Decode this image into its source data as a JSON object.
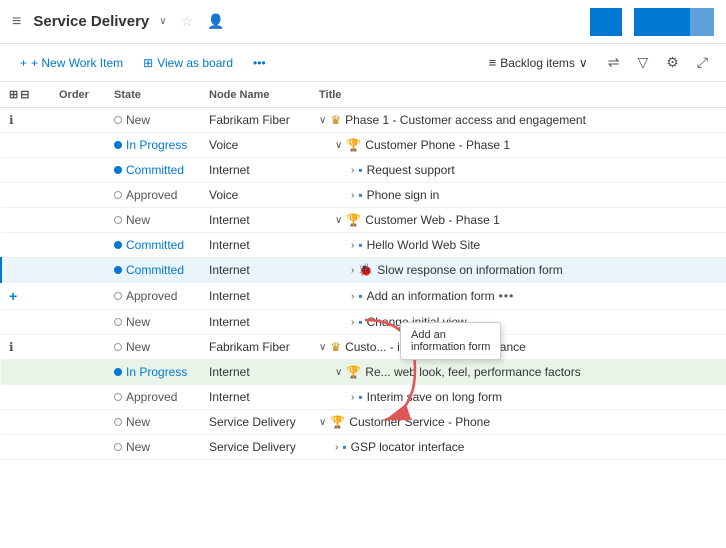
{
  "header": {
    "icon": "≡",
    "title": "Service Delivery",
    "chevron": "∨",
    "star": "☆",
    "person": "👤"
  },
  "toolbar": {
    "new_work_item": "+ New Work Item",
    "view_as_board": "View as board",
    "more_options": "•••",
    "backlog_items": "Backlog items",
    "filter_icon": "▽",
    "settings_icon": "⚙",
    "expand_icon": "⤢"
  },
  "columns": [
    "",
    "Order",
    "State",
    "Node Name",
    "Title"
  ],
  "rows": [
    {
      "id": "r1",
      "expand": "⊕",
      "order": "",
      "order_info": true,
      "state": "New",
      "state_type": "new",
      "node": "Fabrikam Fiber",
      "title_indent": 0,
      "title_chevron": "down",
      "title_icon": "crown",
      "title_text": "Phase 1 - Customer access and engagement",
      "highlighted": false,
      "active": false
    },
    {
      "id": "r2",
      "expand": "",
      "order": "",
      "state": "In Progress",
      "state_type": "inprogress",
      "node": "Voice",
      "title_indent": 1,
      "title_chevron": "down",
      "title_icon": "trophy",
      "title_text": "Customer Phone - Phase 1",
      "highlighted": false,
      "active": false
    },
    {
      "id": "r3",
      "expand": "",
      "order": "",
      "state": "Committed",
      "state_type": "committed",
      "node": "Internet",
      "title_indent": 2,
      "title_chevron": "right",
      "title_icon": "task",
      "title_text": "Request support",
      "highlighted": false,
      "active": false
    },
    {
      "id": "r4",
      "expand": "",
      "order": "",
      "state": "Approved",
      "state_type": "approved",
      "node": "Voice",
      "title_indent": 2,
      "title_chevron": "right",
      "title_icon": "task",
      "title_text": "Phone sign in",
      "highlighted": false,
      "active": false
    },
    {
      "id": "r5",
      "expand": "",
      "order": "",
      "state": "New",
      "state_type": "new",
      "node": "Internet",
      "title_indent": 1,
      "title_chevron": "down",
      "title_icon": "trophy",
      "title_text": "Customer Web - Phase 1",
      "highlighted": false,
      "active": false
    },
    {
      "id": "r6",
      "expand": "",
      "order": "",
      "state": "Committed",
      "state_type": "committed",
      "node": "Internet",
      "title_indent": 2,
      "title_chevron": "right",
      "title_icon": "task",
      "title_text": "Hello World Web Site",
      "highlighted": false,
      "active": false
    },
    {
      "id": "r7",
      "expand": "",
      "order": "",
      "state": "Committed",
      "state_type": "committed",
      "node": "Internet",
      "title_indent": 2,
      "title_chevron": "right",
      "title_icon": "bug",
      "title_text": "Slow response on information form",
      "highlighted": false,
      "active": true
    },
    {
      "id": "r8",
      "expand": "",
      "order": "",
      "state": "Approved",
      "state_type": "approved",
      "node": "Internet",
      "title_indent": 2,
      "title_chevron": "right",
      "title_icon": "task",
      "title_text": "Add an information form",
      "has_more": true,
      "highlighted": false,
      "active": false
    },
    {
      "id": "r9",
      "expand": "",
      "order": "",
      "state": "New",
      "state_type": "new",
      "node": "Internet",
      "title_indent": 2,
      "title_chevron": "right",
      "title_icon": "task",
      "title_text": "Change initial view",
      "highlighted": false,
      "active": false
    },
    {
      "id": "r10",
      "expand": "",
      "order": "",
      "order_info": true,
      "state": "New",
      "state_type": "new",
      "node": "Fabrikam Fiber",
      "title_indent": 0,
      "title_chevron": "down",
      "title_icon": "crown",
      "title_text": "Custo... - improve UI performance",
      "highlighted": false,
      "active": false
    },
    {
      "id": "r11",
      "expand": "",
      "order": "",
      "state": "In Progress",
      "state_type": "inprogress",
      "node": "Internet",
      "title_indent": 1,
      "title_chevron": "down",
      "title_icon": "trophy",
      "title_text": "Re... web look, feel, performance factors",
      "highlighted": true,
      "active": false
    },
    {
      "id": "r12",
      "expand": "",
      "order": "",
      "state": "Approved",
      "state_type": "approved",
      "node": "Internet",
      "title_indent": 2,
      "title_chevron": "right",
      "title_icon": "task",
      "title_text": "Interim save on long form",
      "highlighted": false,
      "active": false
    },
    {
      "id": "r13",
      "expand": "",
      "order": "",
      "state": "New",
      "state_type": "new",
      "node": "Service Delivery",
      "title_indent": 0,
      "title_chevron": "down",
      "title_icon": "trophy",
      "title_text": "Customer Service - Phone",
      "highlighted": false,
      "active": false
    },
    {
      "id": "r14",
      "expand": "",
      "order": "",
      "state": "New",
      "state_type": "new",
      "node": "Service Delivery",
      "title_indent": 1,
      "title_chevron": "right",
      "title_icon": "task",
      "title_text": "GSP locator interface",
      "highlighted": false,
      "active": false
    }
  ],
  "tooltip": {
    "line1": "Add an",
    "line2": "information form"
  },
  "add_row": {
    "plus": "+",
    "label": ""
  }
}
